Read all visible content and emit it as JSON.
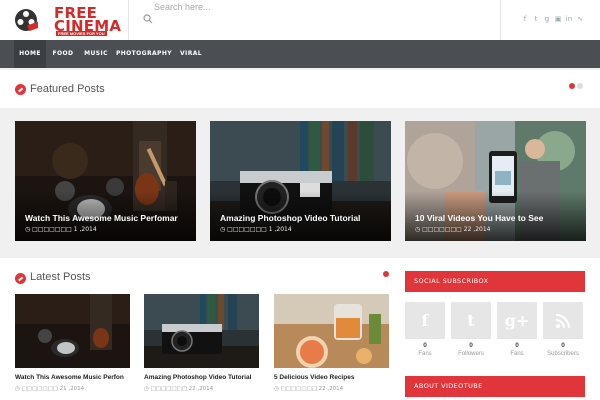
{
  "header": {
    "logo_line1": "FREE",
    "logo_line2": "CINEMA",
    "logo_tagline": "FREE MOVIES FOR YOU",
    "search_placeholder": "Search here...",
    "social_icons": [
      "facebook-icon",
      "twitter-icon",
      "google-plus-icon",
      "instagram-icon",
      "linkedin-icon",
      "rss-icon"
    ]
  },
  "nav": {
    "items": [
      {
        "label": "HOME",
        "active": true
      },
      {
        "label": "FOOD",
        "active": false
      },
      {
        "label": "MUSIC",
        "active": false
      },
      {
        "label": "PHOTOGRAPHY",
        "active": false
      },
      {
        "label": "VIRAL",
        "active": false
      }
    ]
  },
  "featured": {
    "title": "Featured Posts",
    "posts": [
      {
        "title": "Watch This Awesome Music Perfomar",
        "date": "□□□□□□□ 1 ,2014"
      },
      {
        "title": "Amazing Photoshop Video Tutorial",
        "date": "□□□□□□□ 1 ,2014"
      },
      {
        "title": "10 Viral Videos You Have to See",
        "date": "□□□□□□□ 22 ,2014"
      }
    ]
  },
  "latest": {
    "title": "Latest Posts",
    "posts": [
      {
        "title": "Watch This Awesome Music Perfon",
        "date": "□□□□□□□ 21 ,2014"
      },
      {
        "title": "Amazing Photoshop Video Tutorial",
        "date": "□□□□□□□ 22 ,2014"
      },
      {
        "title": "5 Delicious Video Recipes",
        "date": "□□□□□□□ 22 ,2014"
      }
    ]
  },
  "sidebar": {
    "subscribe_title": "SOCIAL SUBSCRIBOX",
    "subscribers": [
      {
        "icon": "f",
        "count": "0",
        "label": "Fans"
      },
      {
        "icon": "t",
        "count": "0",
        "label": "Followers"
      },
      {
        "icon": "g+",
        "count": "0",
        "label": "Fans"
      },
      {
        "icon": "rss",
        "count": "0",
        "label": "Subscribers"
      }
    ],
    "about_title": "ABOUT VIDEOTUBE"
  },
  "colors": {
    "accent": "#e0353b",
    "nav_bg": "#4b4f54"
  }
}
